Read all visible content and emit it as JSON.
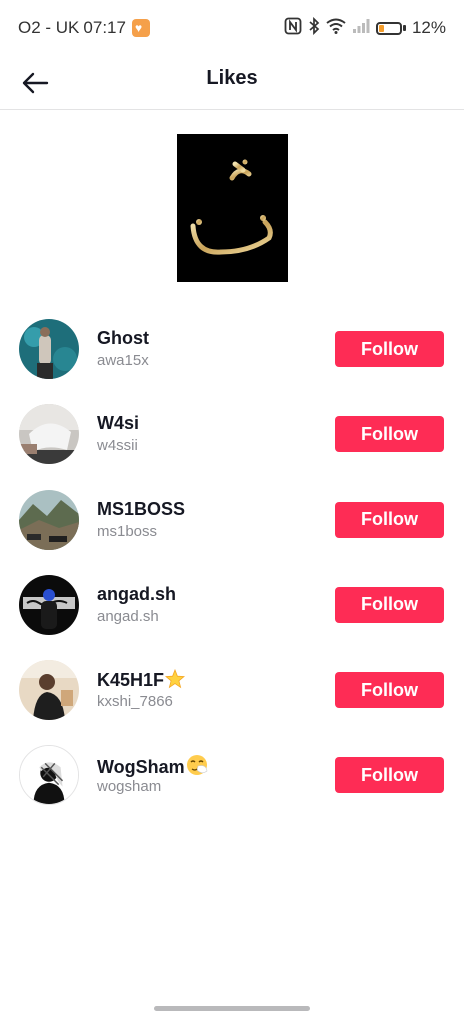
{
  "status_bar": {
    "carrier": "O2 - UK",
    "time": "07:17",
    "battery_percent": "12%",
    "battery_level": 0.12,
    "icons": [
      "heart-notification-icon",
      "nfc-icon",
      "bluetooth-icon",
      "wifi-icon",
      "signal-icon",
      "battery-icon"
    ]
  },
  "header": {
    "title": "Likes",
    "back_icon": "arrow-left-icon"
  },
  "video": {
    "thumbnail_icon": "calligraphy-thumbnail"
  },
  "users": [
    {
      "name": "Ghost",
      "handle": "awa15x",
      "button": "Follow",
      "emoji": ""
    },
    {
      "name": "W4si",
      "handle": "w4ssii",
      "button": "Follow",
      "emoji": ""
    },
    {
      "name": "MS1BOSS",
      "handle": "ms1boss",
      "button": "Follow",
      "emoji": ""
    },
    {
      "name": "angad.sh",
      "handle": "angad.sh",
      "button": "Follow",
      "emoji": ""
    },
    {
      "name": "K45H1F",
      "handle": "kxshi_7866",
      "button": "Follow",
      "emoji": "star"
    },
    {
      "name": "WogSham",
      "handle": "wogsham",
      "button": "Follow",
      "emoji": "sneezing-face"
    }
  ],
  "colors": {
    "follow_button": "#fe2c55",
    "battery_fill": "#f39c2b",
    "handle_text": "#8a8b91"
  }
}
